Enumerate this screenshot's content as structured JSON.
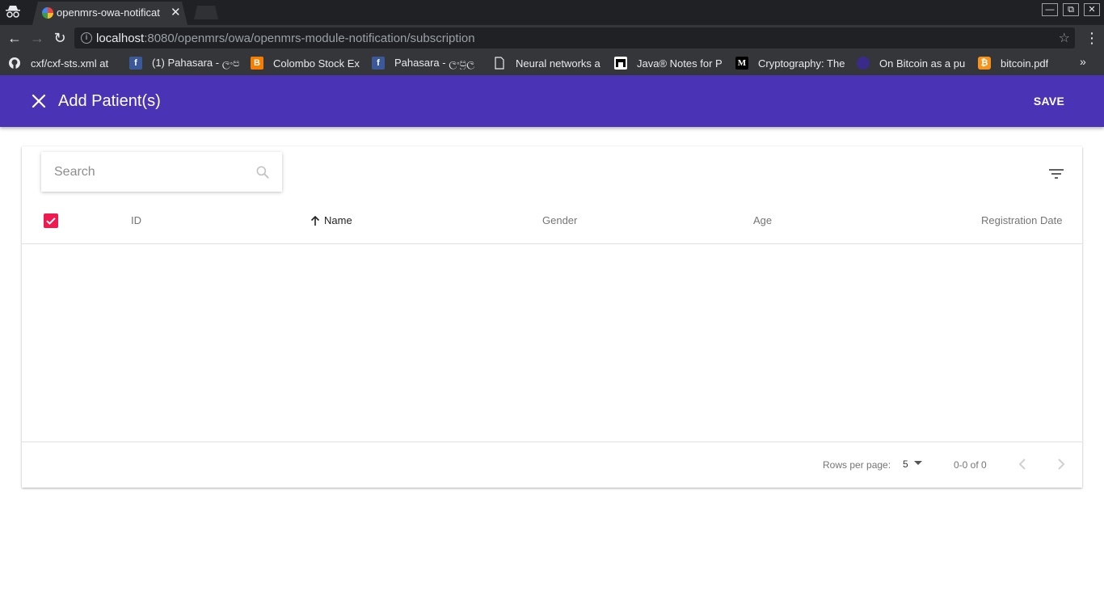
{
  "browser": {
    "tab_title": "openmrs-owa-notificat",
    "url_host": "localhost",
    "url_rest": ":8080/openmrs/owa/openmrs-module-notification/subscription",
    "bookmarks": [
      {
        "label": "cxf/cxf-sts.xml at",
        "icon": "github-icon",
        "color": "#24292e"
      },
      {
        "label": "(1) Pahasara - ලංප",
        "icon": "facebook-icon",
        "color": "#3b5998"
      },
      {
        "label": "Colombo Stock Ex",
        "icon": "blogger-icon",
        "color": "#f57d00"
      },
      {
        "label": "Pahasara - ලංප්‍රල",
        "icon": "facebook-icon",
        "color": "#3b5998"
      },
      {
        "label": "Neural networks a",
        "icon": "page-icon",
        "color": "#35363a"
      },
      {
        "label": "Java® Notes for P",
        "icon": "goalkicker-icon",
        "color": "#000000"
      },
      {
        "label": "Cryptography: The",
        "icon": "medium-icon",
        "color": "#000000"
      },
      {
        "label": "On Bitcoin as a pu",
        "icon": "globe-icon",
        "color": "#3a2a8a"
      },
      {
        "label": "bitcoin.pdf",
        "icon": "bitcoin-icon",
        "color": "#f7931a"
      }
    ]
  },
  "appbar": {
    "title": "Add Patient(s)",
    "save_label": "SAVE",
    "color": "#4a34b5"
  },
  "search": {
    "placeholder": "Search",
    "value": ""
  },
  "table": {
    "columns": [
      "ID",
      "Name",
      "Gender",
      "Age",
      "Registration Date"
    ],
    "sorted_column": "Name",
    "sort_direction": "ascending",
    "select_all_checked": true,
    "rows": []
  },
  "footer": {
    "rows_per_page_label": "Rows per page:",
    "rows_per_page": "5",
    "range": "0-0 of 0"
  },
  "colors": {
    "checkbox": "#ef1a4f"
  }
}
